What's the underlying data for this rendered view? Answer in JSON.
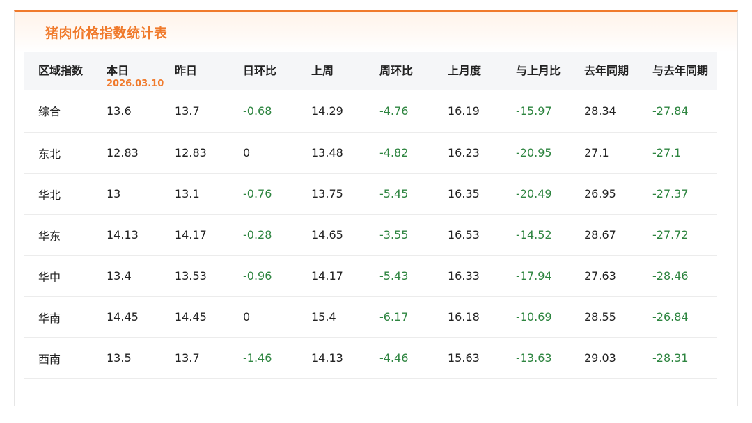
{
  "page": {
    "title": "猪肉价格指数统计表",
    "accent_color": "#f07a2c",
    "negative_color": "#2e8540"
  },
  "table": {
    "headers": [
      {
        "label": "区域指数",
        "sub": ""
      },
      {
        "label": "本日",
        "sub": "2026.03.10"
      },
      {
        "label": "昨日",
        "sub": ""
      },
      {
        "label": "日环比",
        "sub": ""
      },
      {
        "label": "上周",
        "sub": ""
      },
      {
        "label": "周环比",
        "sub": ""
      },
      {
        "label": "上月度",
        "sub": ""
      },
      {
        "label": "与上月比",
        "sub": ""
      },
      {
        "label": "去年同期",
        "sub": ""
      },
      {
        "label": "与去年同期",
        "sub": ""
      }
    ],
    "rows": [
      [
        "综合",
        "13.6",
        "13.7",
        "-0.68",
        "14.29",
        "-4.76",
        "16.19",
        "-15.97",
        "28.34",
        "-27.84"
      ],
      [
        "东北",
        "12.83",
        "12.83",
        "0",
        "13.48",
        "-4.82",
        "16.23",
        "-20.95",
        "27.1",
        "-27.1"
      ],
      [
        "华北",
        "13",
        "13.1",
        "-0.76",
        "13.75",
        "-5.45",
        "16.35",
        "-20.49",
        "26.95",
        "-27.37"
      ],
      [
        "华东",
        "14.13",
        "14.17",
        "-0.28",
        "14.65",
        "-3.55",
        "16.53",
        "-14.52",
        "28.67",
        "-27.72"
      ],
      [
        "华中",
        "13.4",
        "13.53",
        "-0.96",
        "14.17",
        "-5.43",
        "16.33",
        "-17.94",
        "27.63",
        "-28.46"
      ],
      [
        "华南",
        "14.45",
        "14.45",
        "0",
        "15.4",
        "-6.17",
        "16.18",
        "-10.69",
        "28.55",
        "-26.84"
      ],
      [
        "西南",
        "13.5",
        "13.7",
        "-1.46",
        "14.13",
        "-4.46",
        "15.63",
        "-13.63",
        "29.03",
        "-28.31"
      ]
    ]
  }
}
